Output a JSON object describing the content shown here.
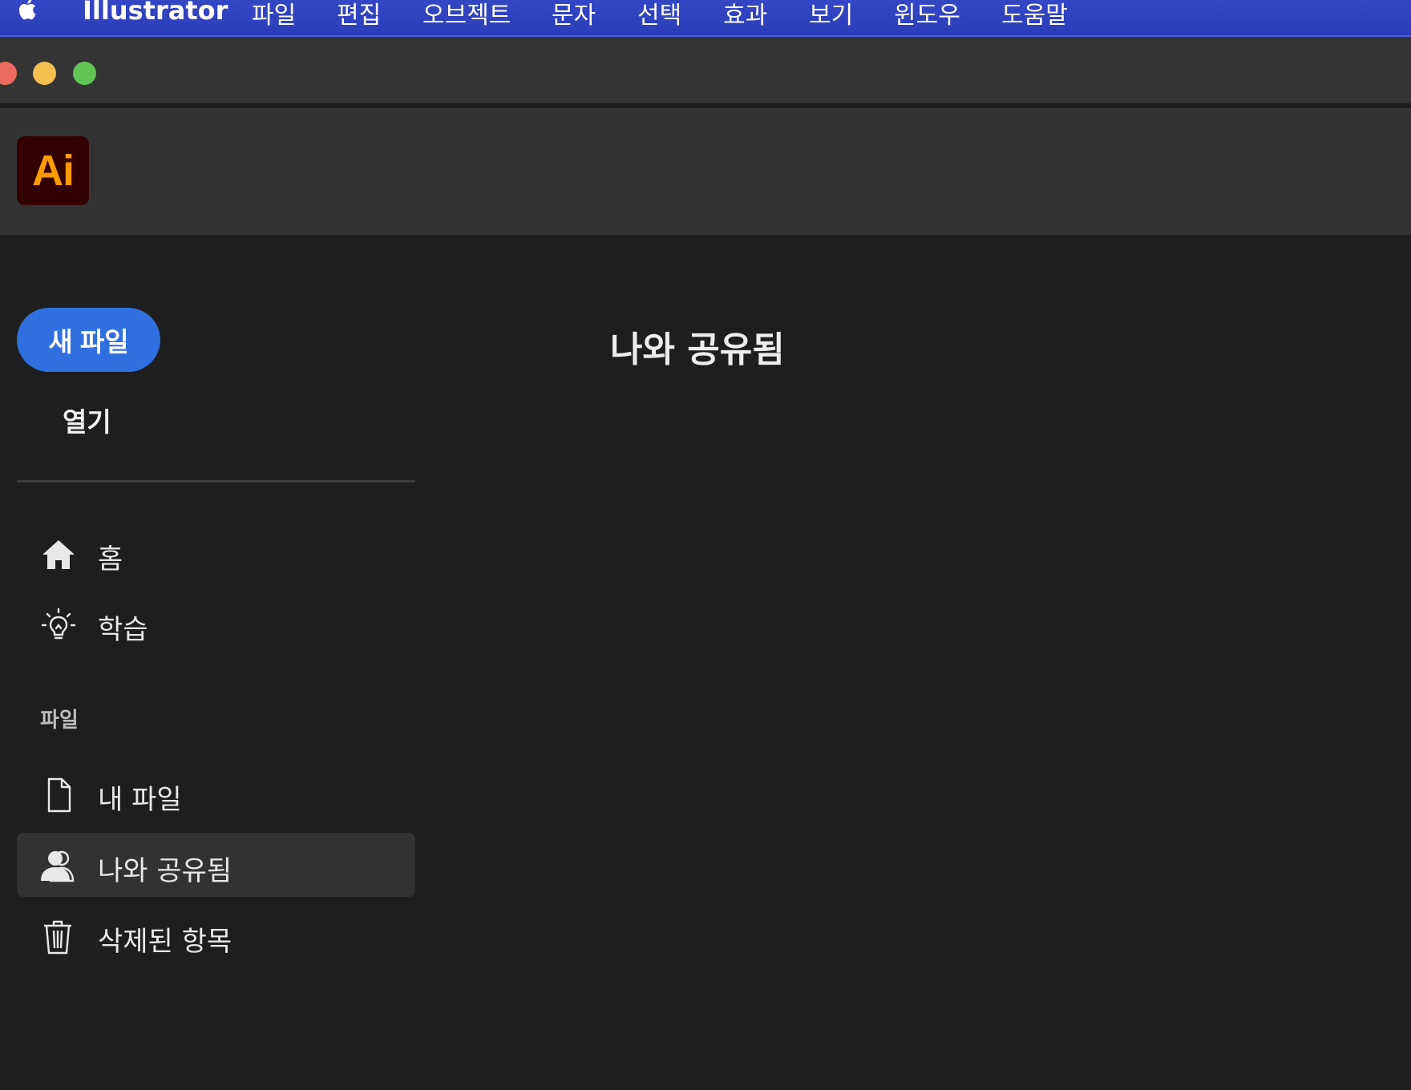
{
  "menubar": {
    "app_name": "Illustrator",
    "items": [
      "파일",
      "편집",
      "오브젝트",
      "문자",
      "선택",
      "효과",
      "보기",
      "윈도우",
      "도움말"
    ]
  },
  "window": {
    "traffic_colors": [
      "#ed6a5e",
      "#f4bf4f",
      "#61c554"
    ]
  },
  "app": {
    "logo_text": "Ai",
    "logo_bg": "#330000",
    "logo_fg": "#ff9a00"
  },
  "sidebar": {
    "new_file_label": "새 파일",
    "open_label": "열기",
    "nav": [
      {
        "label": "홈",
        "icon": "home-icon"
      },
      {
        "label": "학습",
        "icon": "lightbulb-icon"
      }
    ],
    "files_section_label": "파일",
    "file_nav": [
      {
        "label": "내 파일",
        "icon": "document-icon"
      },
      {
        "label": "나와 공유됨",
        "icon": "users-icon",
        "active": true
      },
      {
        "label": "삭제된 항목",
        "icon": "trash-icon"
      }
    ]
  },
  "main": {
    "title": "나와 공유됨"
  },
  "colors": {
    "accent": "#2f6fe0",
    "menubar": "#2b3db8",
    "background": "#1e1e1e"
  }
}
